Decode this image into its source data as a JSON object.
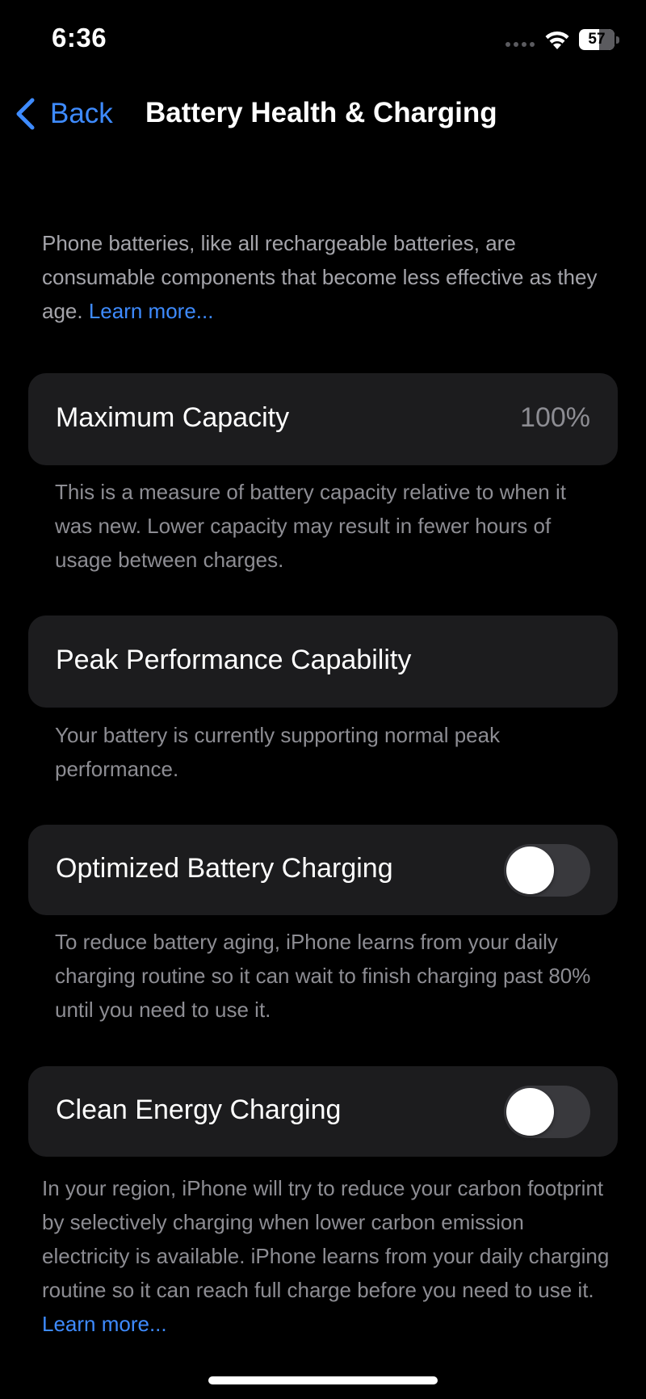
{
  "status_bar": {
    "time": "6:36",
    "battery_percent": 57,
    "battery_label": "57",
    "icons": [
      "signal-dots-icon",
      "wifi-icon",
      "battery-icon"
    ]
  },
  "nav": {
    "back_label": "Back",
    "title": "Battery Health & Charging"
  },
  "intro": {
    "text": "Phone batteries, like all rechargeable batteries, are consumable components that become less effective as they age. ",
    "link": "Learn more..."
  },
  "maximum_capacity": {
    "label": "Maximum Capacity",
    "value": "100%",
    "footer": "This is a measure of battery capacity relative to when it was new. Lower capacity may result in fewer hours of usage between charges."
  },
  "peak_performance": {
    "label": "Peak Performance Capability",
    "footer": "Your battery is currently supporting normal peak performance."
  },
  "optimized_charging": {
    "label": "Optimized Battery Charging",
    "enabled": false,
    "footer": "To reduce battery aging, iPhone learns from your daily charging routine so it can wait to finish charging past 80% until you need to use it."
  },
  "clean_energy": {
    "label": "Clean Energy Charging",
    "enabled": false,
    "footer": "In your region, iPhone will try to reduce your carbon footprint by selectively charging when lower carbon emission electricity is available. iPhone learns from your daily charging routine so it can reach full charge before you need to use it. ",
    "link": "Learn more..."
  },
  "colors": {
    "background": "#000000",
    "card": "#1c1c1e",
    "accent": "#3e8bff",
    "secondary_text": "#8d8d93",
    "toggle_off": "#39393d"
  }
}
